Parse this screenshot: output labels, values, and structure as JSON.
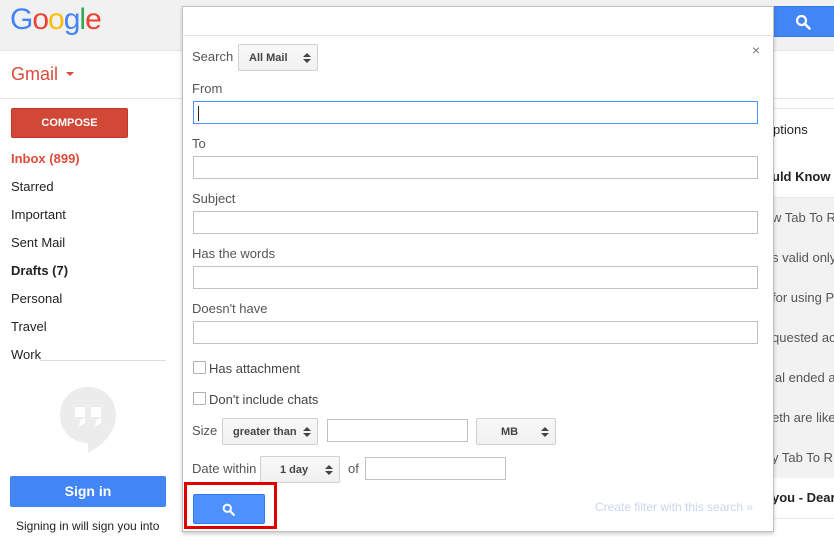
{
  "header": {
    "logo_letters": [
      "G",
      "o",
      "o",
      "g",
      "l",
      "e"
    ],
    "logo_colors": [
      "#4285f4",
      "#ea4335",
      "#fbbc05",
      "#4285f4",
      "#34a853",
      "#ea4335"
    ],
    "search_icon": "search-icon"
  },
  "app": {
    "title": "Gmail"
  },
  "sidebar": {
    "compose": "COMPOSE",
    "items": [
      {
        "label": "Inbox (899)"
      },
      {
        "label": "Starred"
      },
      {
        "label": "Important"
      },
      {
        "label": "Sent Mail"
      },
      {
        "label": "Drafts (7)"
      },
      {
        "label": "Personal"
      },
      {
        "label": "Travel"
      },
      {
        "label": "Work"
      }
    ],
    "hangouts_icon": "hangouts-icon",
    "signin_button": "Sign in",
    "signin_note": "Signing in will sign you into"
  },
  "email_list": {
    "options_label": "ptions",
    "rows": [
      {
        "text": "uld Know -",
        "unread": true
      },
      {
        "text": "w Tab To R",
        "unread": false
      },
      {
        "text": "s valid only",
        "unread": false
      },
      {
        "text": "for using P",
        "unread": false
      },
      {
        "text": "quested ac",
        "unread": false
      },
      {
        "text": "ial ended a",
        "unread": false
      },
      {
        "text": "eth are like",
        "unread": false
      },
      {
        "text": "y Tab To R",
        "unread": false
      },
      {
        "text": "you - Dear",
        "unread": true
      }
    ]
  },
  "advanced_search": {
    "search_label": "Search",
    "search_scope": "All Mail",
    "from_label": "From",
    "from_value": "",
    "to_label": "To",
    "subject_label": "Subject",
    "has_words_label": "Has the words",
    "doesnt_have_label": "Doesn't have",
    "has_attachment_label": "Has attachment",
    "dont_include_chats_label": "Don't include chats",
    "size_label": "Size",
    "size_operator": "greater than",
    "size_unit": "MB",
    "date_within_label": "Date within",
    "date_within_value": "1 day",
    "of_label": "of",
    "create_filter_link": "Create filter with this search »",
    "close_symbol": "×"
  },
  "colors": {
    "accent_blue": "#4285f4",
    "compose_red": "#d14836",
    "highlight_red": "#e00000"
  }
}
